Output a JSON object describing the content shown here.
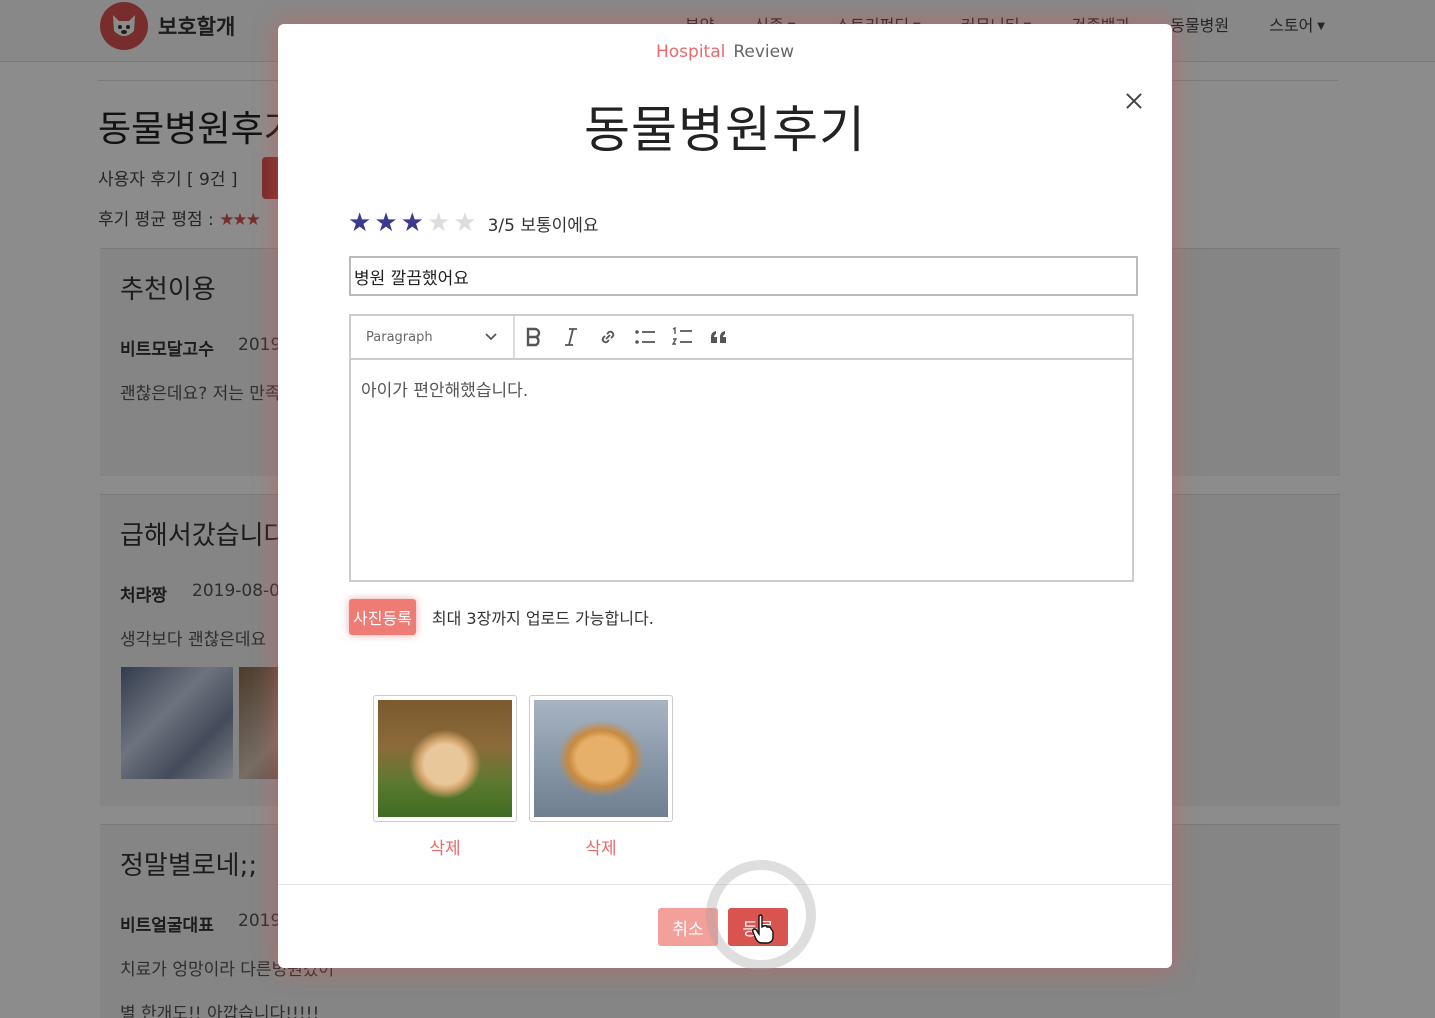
{
  "nav": {
    "brand": "보호할개",
    "items": [
      {
        "label": "분양"
      },
      {
        "label": "신종"
      },
      {
        "label": "스토리펀딩"
      },
      {
        "label": "커뮤니티"
      },
      {
        "label": "건종백과"
      },
      {
        "label": "동물병원"
      },
      {
        "label": "스토어"
      }
    ]
  },
  "background": {
    "title": "동물병원후기",
    "review_count": "사용자 후기 [ 9건 ]",
    "avg_rating_label": "후기 평균 평점 :",
    "avg_rating_stars": "★★★",
    "reviews": [
      {
        "title": "추천이용",
        "author": "비트모달고수",
        "date": "2019",
        "body": "괜찮은데요? 저는 만족"
      },
      {
        "title": "급해서갔습니다",
        "author": "처랴짱",
        "date": "2019-08-0",
        "body": "생각보다 괜찮은데요"
      },
      {
        "title": "정말별로네;;",
        "author": "비트얼굴대표",
        "date": "2019",
        "body": "치료가 엉망이라 다른병원갔어",
        "body2": "별 한개도!! 아깝습니다!!!!!"
      }
    ]
  },
  "modal": {
    "eyebrow_left": "Hospital",
    "eyebrow_right": "Review",
    "title": "동물병원후기",
    "rating": {
      "value": 3,
      "max": 5,
      "text": "3/5 보통이에요"
    },
    "title_value": "병원 깔끔했어요",
    "editor": {
      "format_select": "Paragraph",
      "content": "아이가 편안해했습니다."
    },
    "upload": {
      "button_label": "사진등록",
      "note": "최대 3장까지 업로드 가능합니다."
    },
    "photos": [
      {
        "delete_label": "삭제"
      },
      {
        "delete_label": "삭제"
      }
    ],
    "footer": {
      "cancel_label": "취소",
      "submit_label": "등록"
    }
  },
  "colors": {
    "accent": "#d9534f",
    "accent_light": "#f4a09a",
    "star_on": "#3c3a8e"
  }
}
